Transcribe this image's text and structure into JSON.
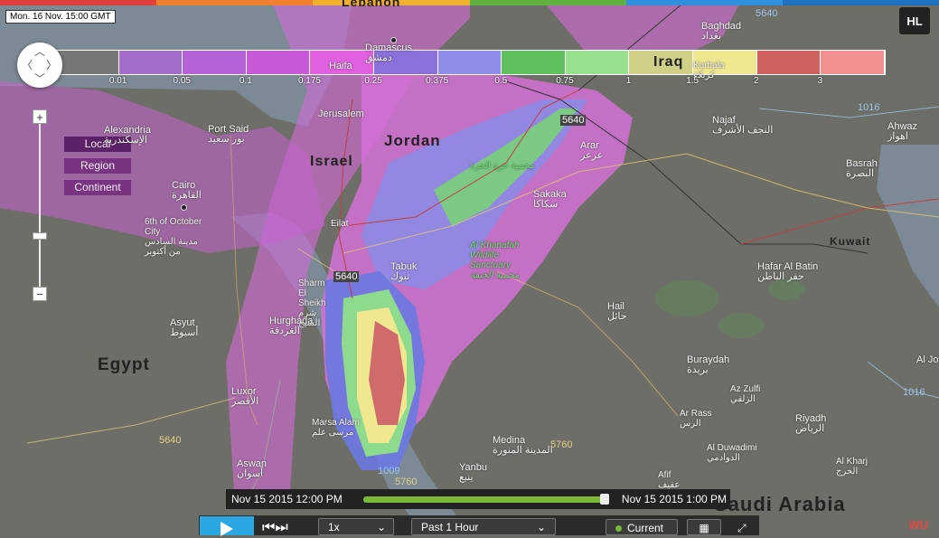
{
  "timestamp": "Mon. 16 Nov. 15:00 GMT",
  "logo": "HL",
  "legend": {
    "colors": [
      "#777777",
      "#a36cc8",
      "#b363d6",
      "#c65ad6",
      "#e060e0",
      "#8a70d8",
      "#8e8ee8",
      "#60c060",
      "#98e090",
      "#d0d088",
      "#f0e890",
      "#d06060",
      "#f09090"
    ],
    "ticks": [
      "0.01",
      "0.05",
      "0.1",
      "0.175",
      "0.25",
      "0.375",
      "0.5",
      "0.75",
      "1",
      "1.5",
      "2",
      "3"
    ]
  },
  "scope": [
    "Local",
    "Region",
    "Continent"
  ],
  "countries": {
    "egypt": "Egypt",
    "jordan": "Jordan",
    "israel": "Israel",
    "iraq": "Iraq",
    "kuwait": "Kuwait",
    "saudi": "Saudi Arabia",
    "lebanon": "Lebanon"
  },
  "cities": {
    "damascus": "Damascus",
    "damascus_ar": "دمشق",
    "haifa": "Haifa",
    "jerusalem": "Jerusalem",
    "alexandria": "Alexandria",
    "alexandria_ar": "الإسكندرية",
    "port_said": "Port Said",
    "port_said_ar": "بور سعيد",
    "cairo": "Cairo",
    "cairo_ar": "القاهرة",
    "october": "6th of October City",
    "october_ar": "مدينة السادس من أكتوبر",
    "eilat": "Eilat",
    "sharm": "Sharm El Sheikh",
    "sharm_ar": "شرم الشيخ",
    "hurghada": "Hurghada",
    "hurghada_ar": "الغردقة",
    "asyut": "Asyut",
    "asyut_ar": "أسيوط",
    "luxor": "Luxor",
    "luxor_ar": "الأقصر",
    "marsa": "Marsa Alam",
    "marsa_ar": "مرسى علم",
    "aswan": "Aswan",
    "aswan_ar": "أسوان",
    "tabuk": "Tabuk",
    "tabuk_ar": "تبوك",
    "khanafah": "Al Khanafah Wildlife Sanctuary",
    "khanafah_ar": "محمية الخنفة",
    "harrat": "محمية حرة الحرة",
    "sakaka": "Sakaka",
    "sakaka_ar": "سكاكا",
    "arar": "Arar",
    "arar_ar": "عرعر",
    "baghdad": "Baghdad",
    "baghdad_ar": "بغداد",
    "karbala": "Karbala",
    "karbala_ar": "كربلاء",
    "najaf": "Najaf",
    "najaf_ar": "النجف الأشرف",
    "ahwaz": "Ahwaz",
    "ahwaz_ar": "اهواز",
    "basrah": "Basrah",
    "basrah_ar": "البصرة",
    "hafar": "Hafar Al Batin",
    "hafar_ar": "حفر الباطن",
    "hail": "Hail",
    "hail_ar": "حائل",
    "buraydah": "Buraydah",
    "buraydah_ar": "بريدة",
    "zulfi": "Az Zulfi",
    "zulfi_ar": "الزلفي",
    "ar_rass": "Ar Rass",
    "ar_rass_ar": "الرس",
    "duwadimi": "Al Duwadimi",
    "duwadimi_ar": "الدوادمي",
    "riyadh": "Riyadh",
    "riyadh_ar": "الرياض",
    "kharj": "Al Kharj",
    "kharj_ar": "الخرج",
    "medina": "Medina",
    "medina_ar": "المدينة المنورة",
    "yanbu": "Yanbu",
    "yanbu_ar": "ينبع",
    "afif": "Afif",
    "afif_ar": "عفيف",
    "jubail": "Al Jo"
  },
  "pressure": {
    "p5640a": "5640",
    "p5640b": "5640",
    "p5640c": "5640",
    "p5640d": "5640",
    "p5760a": "5760",
    "p5760b": "5760",
    "p1009": "1009",
    "p1016a": "1016",
    "p1016b": "1016"
  },
  "timeline": {
    "start": "Nov 15 2015 12:00 PM",
    "end": "Nov 15 2015 1:00 PM"
  },
  "controls": {
    "speed": "1x",
    "period": "Past 1 Hour",
    "current": "Current"
  }
}
